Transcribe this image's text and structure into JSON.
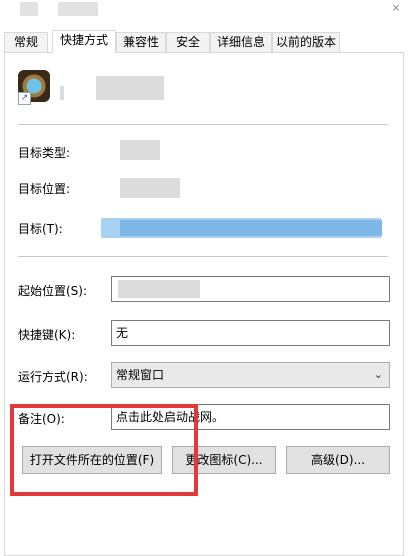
{
  "tabs": [
    "常规",
    "快捷方式",
    "兼容性",
    "安全",
    "详细信息",
    "以前的版本"
  ],
  "fields": {
    "target_type_label": "目标类型:",
    "target_location_label": "目标位置:",
    "target_label": "目标(T):",
    "start_in_label": "起始位置(S):",
    "shortcut_key_label": "快捷键(K):",
    "shortcut_key_value": "无",
    "run_label": "运行方式(R):",
    "run_value": "常规窗口",
    "comment_label": "备注(O):",
    "comment_value": "点击此处启动战网。"
  },
  "buttons": {
    "open_location": "打开文件所在的位置(F)",
    "change_icon": "更改图标(C)...",
    "advanced": "高级(D)..."
  },
  "colors": {
    "highlight": "#e23a3a",
    "selection": "#7fb8e8"
  }
}
